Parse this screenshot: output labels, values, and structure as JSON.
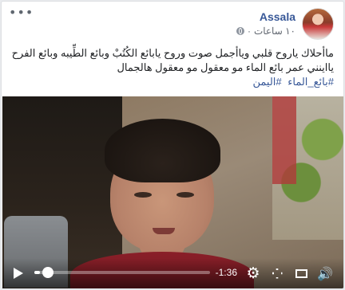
{
  "post": {
    "page_name": "Assala",
    "timestamp": "١٠ ساعات",
    "text": "ماأحلاك ياروح قلبي وياأجمل صوت وروح يابائع الكُتُبْ وبائع الطِّيبه وبائع الفرح يااينني عمر بائع الماء مو معقول مو معقول هالجمال",
    "hashtags": [
      "#بائع_الماء",
      "#اليمن"
    ],
    "privacy_icon": "globe-icon"
  },
  "video": {
    "time_remaining": "-1:36",
    "progress_fraction": 0.03,
    "controls": {
      "play": "play-icon",
      "settings": "gear-icon",
      "fullscreen": "expand-icon",
      "popout": "popout-icon",
      "volume": "speaker-icon"
    }
  },
  "colors": {
    "link": "#385898",
    "text": "#1c1e21",
    "meta": "#616770",
    "card_border": "#dddfe2"
  }
}
